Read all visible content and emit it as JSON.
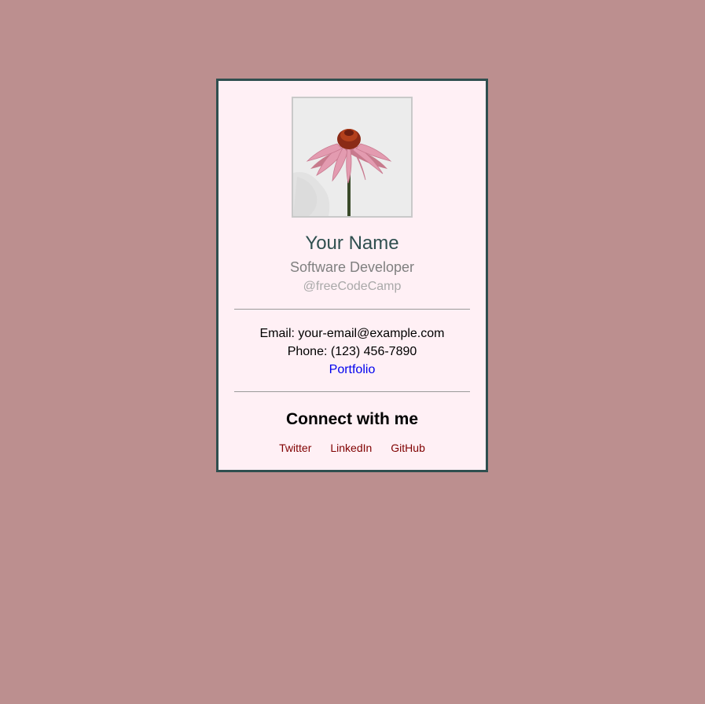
{
  "profile": {
    "name": "Your Name",
    "role": "Software Developer",
    "handle": "@freeCodeCamp",
    "avatar_icon": "flower-photo"
  },
  "contact": {
    "email": "Email: your-email@example.com",
    "phone": "Phone: (123) 456-7890",
    "portfolio_label": "Portfolio"
  },
  "social": {
    "heading": "Connect with me",
    "links": [
      {
        "label": "Twitter"
      },
      {
        "label": "LinkedIn"
      },
      {
        "label": "GitHub"
      }
    ]
  },
  "colors": {
    "page_background": "#bc8f8f",
    "card_background": "#fff0f5",
    "card_border": "#2f4f4f",
    "name_color": "#2f4f4f",
    "link_color": "#0000ee",
    "social_link_color": "#800000"
  }
}
